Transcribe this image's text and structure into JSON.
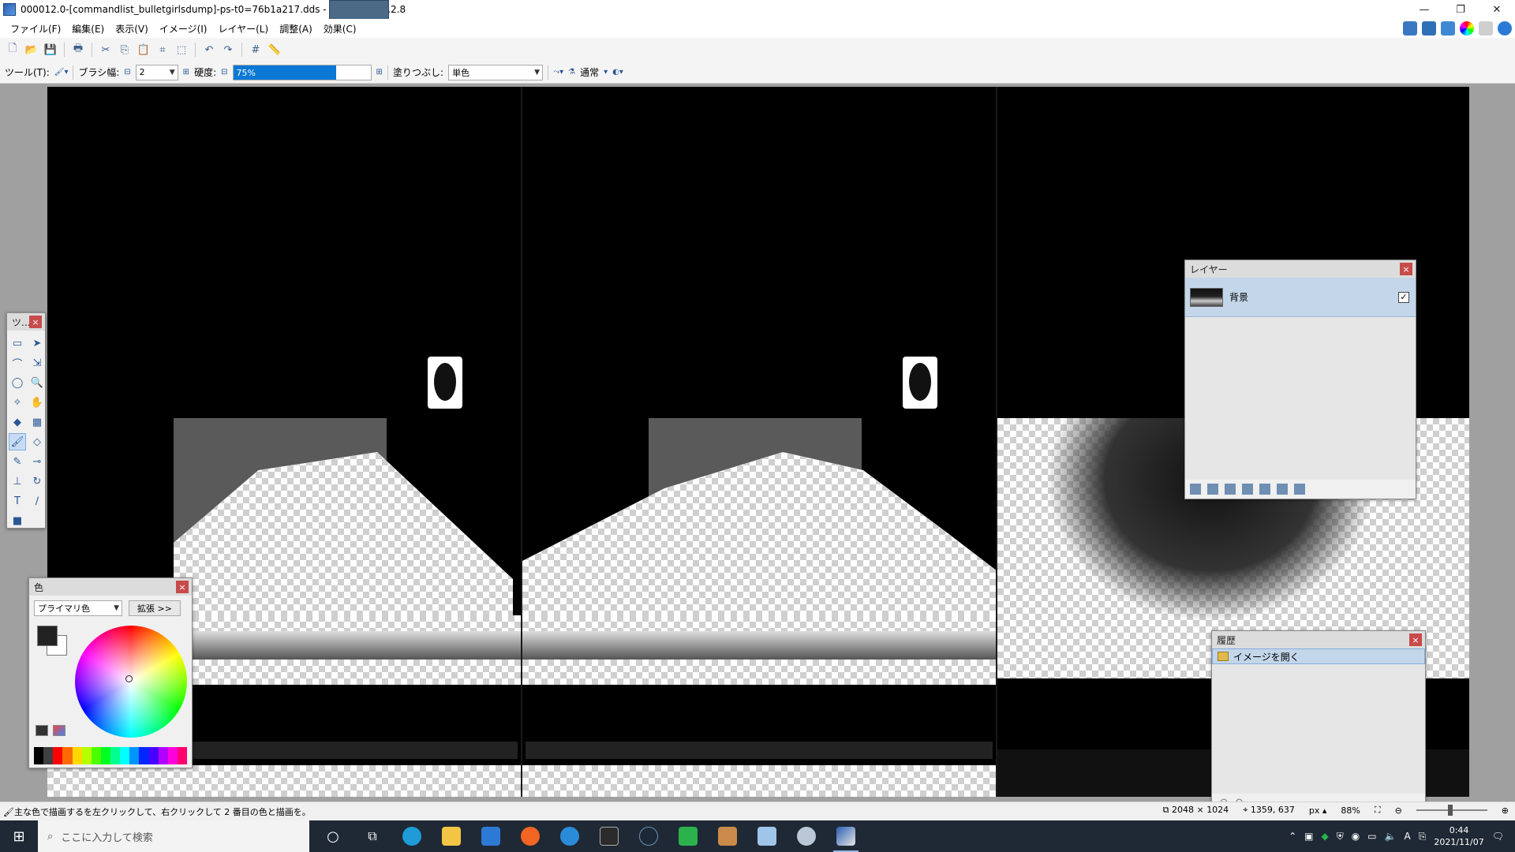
{
  "window": {
    "title": "000012.0-[commandlist_bulletgirlsdump]-ps-t0=76b1a217.dds - paint.net V4.2.8",
    "minimize": "—",
    "restore": "❐",
    "close": "✕"
  },
  "menu": {
    "items": [
      "ファイル(F)",
      "編集(E)",
      "表示(V)",
      "イメージ(I)",
      "レイヤー(L)",
      "調整(A)",
      "効果(C)"
    ]
  },
  "toolbar2": {
    "tool_label": "ツール(T):",
    "brush_width_label": "ブラシ幅:",
    "brush_width_value": "2",
    "hardness_label": "硬度:",
    "hardness_value": "75%",
    "hardness_fraction": 0.75,
    "fill_label": "塗りつぶし:",
    "fill_value": "単色",
    "blend_value": "通常"
  },
  "tools_window": {
    "title": "ツ..."
  },
  "colors_window": {
    "title": "色",
    "mode_value": "プライマリ色",
    "expand_label": "拡張 >>",
    "primary_color": "#222222",
    "secondary_color": "#ffffff"
  },
  "layers_window": {
    "title": "レイヤー",
    "layer_name": "背景",
    "visible_check": "✓"
  },
  "history_window": {
    "title": "履歴",
    "item": "イメージを開く"
  },
  "statusbar": {
    "message": "主な色で描画するを左クリックして、右クリックして 2 番目の色と描画を。",
    "image_size": "2048 × 1024",
    "cursor_pos": "1359, 637",
    "unit": "px",
    "zoom": "88%"
  },
  "taskbar": {
    "search_placeholder": "ここに入力して検索",
    "time": "0:44",
    "date": "2021/11/07"
  },
  "icons": {
    "brush": "brush-icon"
  }
}
